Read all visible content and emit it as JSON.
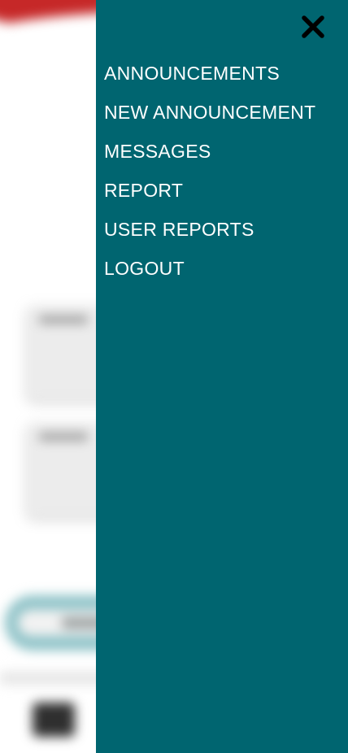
{
  "drawer": {
    "background_color": "#006570",
    "close_icon": "close-icon",
    "menu_items": [
      {
        "label": "ANNOUNCEMENTS"
      },
      {
        "label": "NEW ANNOUNCEMENT"
      },
      {
        "label": "MESSAGES"
      },
      {
        "label": "REPORT"
      },
      {
        "label": "USER REPORTS"
      },
      {
        "label": "LOGOUT"
      }
    ]
  },
  "background": {
    "accent_color": "#c62828",
    "input_color": "#8fc3c8",
    "chat_icon": "chat-icon"
  }
}
